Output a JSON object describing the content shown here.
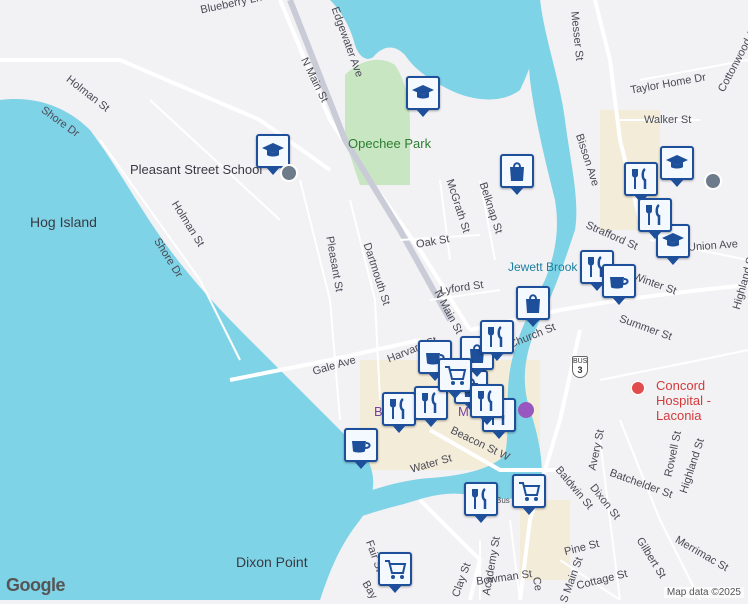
{
  "labels": {
    "hog_island": "Hog Island",
    "dixon_point": "Dixon Point",
    "opechee_park": "Opechee Park",
    "pleasant_street_school": "Pleasant Street School",
    "jewett_brook": "Jewett Brook",
    "concord_hospital": "Concord Hospital - Laconia",
    "beacon_partial": "B",
    "m_partial": "M"
  },
  "streets": [
    "Blueberry Ln",
    "Edgewater Ave",
    "N Main St",
    "Holman St",
    "Shore Dr",
    "Holman St",
    "Shore Dr",
    "Pleasant St",
    "Dartmouth St",
    "McGrath St",
    "Belknap St",
    "Oak St",
    "Lyford St",
    "N Main St",
    "Harvard St",
    "Gale Ave",
    "Beacon St W",
    "Water St",
    "Messer St",
    "Bisson Ave",
    "Taylor Home Dr",
    "Walker St",
    "Cottonwood Ave",
    "Strafford St",
    "Winter St",
    "Summer St",
    "Highland St",
    "Church St",
    "Union Ave",
    "Avery St",
    "Batchelder St",
    "Rowell St",
    "Highland St",
    "Baldwin St",
    "Dixon St",
    "Gilbert St",
    "Merrimac St",
    "Pine St",
    "Cottage St",
    "Bowman St",
    "Clay St",
    "Academy St",
    "S Main St",
    "Fair St",
    "Ce",
    "Bay",
    "Bus"
  ],
  "route_shield": {
    "top": "BUS",
    "number": "3"
  },
  "footer": {
    "logo": "Google",
    "attribution": "Map data ©2025"
  },
  "colors": {
    "water": "#7fd3e6",
    "park": "#c8e6c2",
    "pin_border": "#1d4f9a",
    "land": "#f2f1f4"
  }
}
